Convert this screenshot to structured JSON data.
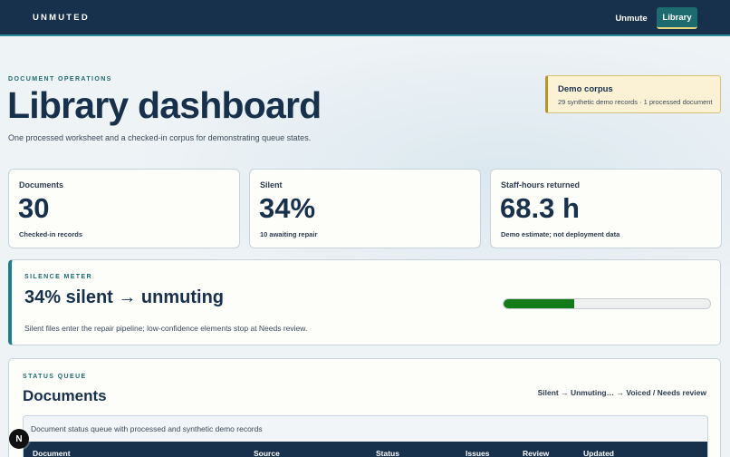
{
  "topbar": {
    "brand": "UNMUTED",
    "nav": [
      {
        "label": "Unmute",
        "active": false
      },
      {
        "label": "Library",
        "active": true
      }
    ]
  },
  "header": {
    "eyebrow": "DOCUMENT OPERATIONS",
    "title": "Library dashboard",
    "subtitle": "One processed worksheet and a checked-in corpus for demonstrating queue states."
  },
  "demo_corpus": {
    "title": "Demo corpus",
    "text": "29 synthetic demo records · 1 processed document"
  },
  "stats": [
    {
      "label": "Documents",
      "value": "30",
      "note": "Checked-in records"
    },
    {
      "label": "Silent",
      "value": "34%",
      "note": "10 awaiting repair"
    },
    {
      "label": "Staff-hours returned",
      "value": "68.3 h",
      "note": "Demo estimate; not deployment data"
    }
  ],
  "meter": {
    "eyebrow": "SILENCE METER",
    "title": "34% silent → unmuting",
    "description": "Silent files enter the repair pipeline; low-confidence elements stop at Needs review.",
    "fill_percent": 34,
    "fill_color": "#137b18"
  },
  "queue": {
    "eyebrow": "STATUS QUEUE",
    "title": "Documents",
    "flow": "Silent → Unmuting… → Voiced / Needs review",
    "caption": "Document status queue with processed and synthetic demo records",
    "columns": [
      "Document",
      "Source",
      "Status",
      "Issues",
      "Review",
      "Updated"
    ]
  },
  "floating_badge": {
    "letter": "N"
  },
  "colors": {
    "navy": "#17304b",
    "teal": "#1d6a6f",
    "accent_underline": "#e3d47a",
    "demo_bg": "#fbf2d5"
  }
}
